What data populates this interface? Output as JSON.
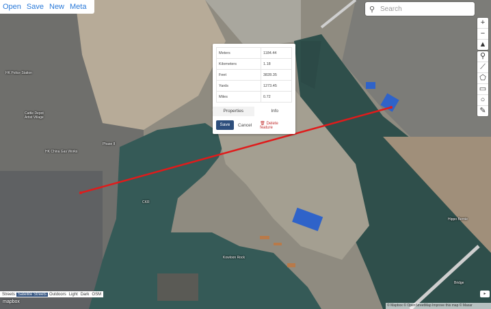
{
  "menu": [
    "Open",
    "Save",
    "New",
    "Meta"
  ],
  "search": {
    "placeholder": "Search",
    "icon": "search-icon"
  },
  "controls": {
    "zoom": [
      "+",
      "−",
      "▲"
    ],
    "draw": [
      "⚲",
      "⟋",
      "⬠",
      "▭",
      "○",
      "✎"
    ]
  },
  "popup": {
    "rows": [
      {
        "k": "Meters",
        "v": "1184.44"
      },
      {
        "k": "Kilometers",
        "v": "1.18"
      },
      {
        "k": "Feet",
        "v": "3828.35"
      },
      {
        "k": "Yards",
        "v": "1273.45"
      },
      {
        "k": "Miles",
        "v": "0.72"
      }
    ],
    "tabs": [
      "Properties",
      "Info"
    ],
    "save": "Save",
    "cancel": "Cancel",
    "delete": "Delete feature",
    "delete_icon": "trash-icon"
  },
  "labels": {
    "kowloon_rock": "Kowloon Rock",
    "cattle_depot": "Cattle Depot Artist Village",
    "hk_gas": "HK China Gas Works",
    "phase2": "Phase II",
    "bridge": "Bridge",
    "hippo": "Hippo Bernie",
    "dragon": "Dragon Centre",
    "kai_tak": "Kai Tak",
    "ckr": "CKR",
    "mui_wo": "Mui Wo",
    "hk_police": "HK Police Station"
  },
  "map_styles": [
    "Streets",
    "Satellite Streets",
    "Outdoors",
    "Light",
    "Dark",
    "OSM"
  ],
  "selected_style": "Satellite Streets",
  "logo": "mapbox",
  "attribution": "© Mapbox © OpenStreetMap Improve this map © Maxar",
  "collapse": "▸",
  "colors": {
    "line": "#e01b1b",
    "accent": "#2d4e7c",
    "link": "#2a7ad9",
    "water": "#355a57"
  }
}
